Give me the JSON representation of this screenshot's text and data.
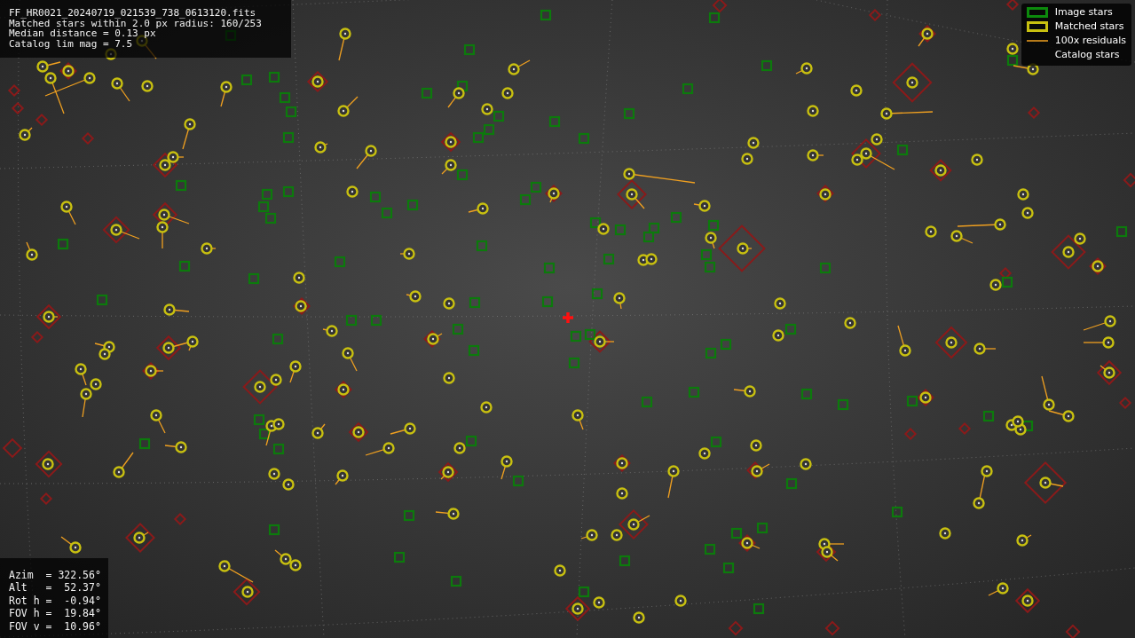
{
  "info": {
    "lines": [
      "FF_HR0021_20240719_021539_738_0613120.fits",
      "Matched stars within 2.0 px radius: 160/253",
      "Median distance = 0.13 px",
      "Catalog lim mag = 7.5"
    ]
  },
  "legend": [
    {
      "kind": "image",
      "label": "Image stars"
    },
    {
      "kind": "matched",
      "label": "Matched stars"
    },
    {
      "kind": "residual",
      "label": "100x residuals"
    },
    {
      "kind": "catalog",
      "label": "Catalog stars"
    }
  ],
  "pointing": {
    "lines": [
      "Azim  = 322.56°",
      "Alt   =  52.37°",
      "Rot h =  -0.94°",
      "FOV h =  19.84°",
      "FOV v =  10.96°"
    ]
  }
}
